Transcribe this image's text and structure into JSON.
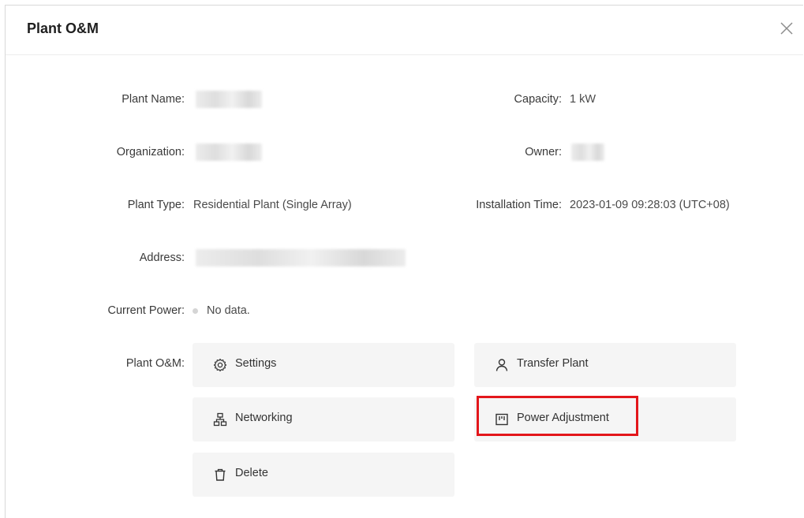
{
  "dialog": {
    "title": "Plant O&M"
  },
  "icons": {
    "close": "close-icon",
    "settings": "gear-icon",
    "transfer": "user-icon",
    "networking": "network-icon",
    "power": "power-adjust-icon",
    "delete": "trash-icon"
  },
  "fields": {
    "plant_name_label": "Plant Name:",
    "organization_label": "Organization:",
    "plant_type_label": "Plant Type:",
    "plant_type_value": "Residential Plant (Single Array)",
    "address_label": "Address:",
    "current_power_label": "Current Power:",
    "current_power_value": "No data.",
    "plant_om_label": "Plant O&M:",
    "capacity_label": "Capacity:",
    "capacity_value": "1 kW",
    "owner_label": "Owner:",
    "installation_label": "Installation Time:",
    "installation_value": "2023-01-09 09:28:03 (UTC+08)"
  },
  "actions": {
    "settings": "Settings",
    "transfer_plant": "Transfer Plant",
    "networking": "Networking",
    "power_adjustment": "Power Adjustment",
    "delete": "Delete"
  },
  "colors": {
    "highlight": "#e3161b",
    "button_bg": "#f5f5f5"
  }
}
